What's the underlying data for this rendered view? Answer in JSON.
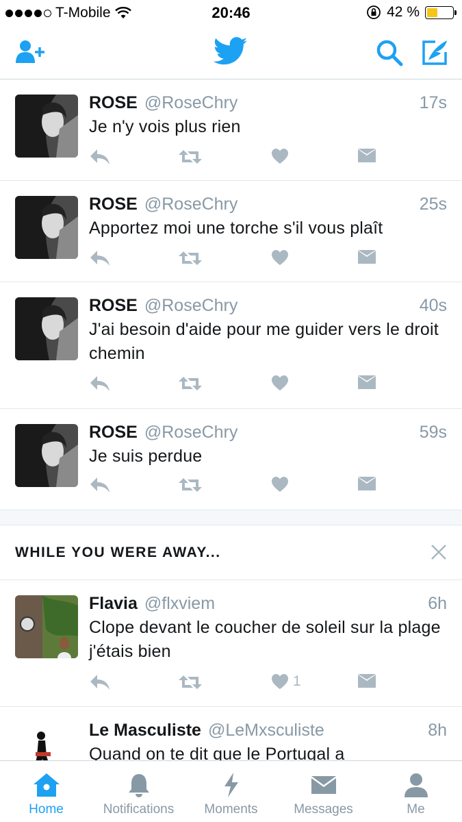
{
  "status_bar": {
    "carrier": "T-Mobile",
    "time": "20:46",
    "battery": "42 %",
    "battery_level": 0.42
  },
  "nav": {
    "add_user_icon": "add-user-icon",
    "logo_icon": "twitter-bird-icon",
    "search_icon": "search-icon",
    "compose_icon": "compose-icon"
  },
  "colors": {
    "accent": "#1da1f2",
    "secondary_text": "#8899a6",
    "action_icon": "#aab8c2",
    "divider": "#e1e8ed"
  },
  "tweets": [
    {
      "name": "ROSE",
      "handle": "@RoseChry",
      "time": "17s",
      "text": "Je n'y vois plus rien",
      "likes": ""
    },
    {
      "name": "ROSE",
      "handle": "@RoseChry",
      "time": "25s",
      "text": "Apportez moi une torche s'il vous plaît",
      "likes": ""
    },
    {
      "name": "ROSE",
      "handle": "@RoseChry",
      "time": "40s",
      "text": "J'ai besoin d'aide pour me guider vers le droit chemin",
      "likes": ""
    },
    {
      "name": "ROSE",
      "handle": "@RoseChry",
      "time": "59s",
      "text": "Je suis perdue",
      "likes": ""
    }
  ],
  "away": {
    "title": "WHILE YOU WERE AWAY...",
    "tweets": [
      {
        "name": "Flavia",
        "handle": "@flxviem",
        "time": "6h",
        "text": "Clope devant le coucher de soleil sur la plage j'étais bien",
        "likes": "1"
      },
      {
        "name": "Le Masculiste",
        "handle": "@LeMxsculiste",
        "time": "8h",
        "text": "Quand on te dit que le Portugal a",
        "likes": ""
      }
    ]
  },
  "tabs": [
    {
      "label": "Home",
      "icon": "home-icon",
      "active": true
    },
    {
      "label": "Notifications",
      "icon": "bell-icon",
      "active": false
    },
    {
      "label": "Moments",
      "icon": "lightning-icon",
      "active": false
    },
    {
      "label": "Messages",
      "icon": "envelope-icon",
      "active": false
    },
    {
      "label": "Me",
      "icon": "person-icon",
      "active": false
    }
  ]
}
